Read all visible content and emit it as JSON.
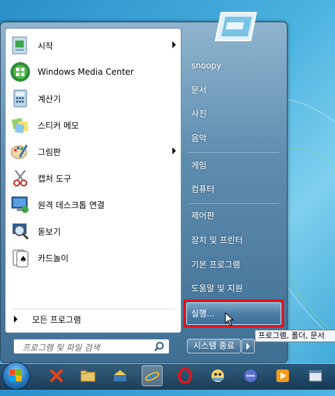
{
  "start_menu": {
    "programs": [
      {
        "label": "시작",
        "icon": "getting-started-icon",
        "has_submenu": true
      },
      {
        "label": "Windows Media Center",
        "icon": "media-center-icon",
        "has_submenu": false
      },
      {
        "label": "계산기",
        "icon": "calculator-icon",
        "has_submenu": false
      },
      {
        "label": "스티커 메모",
        "icon": "sticky-notes-icon",
        "has_submenu": false
      },
      {
        "label": "그림판",
        "icon": "paint-icon",
        "has_submenu": true
      },
      {
        "label": "캡처 도구",
        "icon": "snipping-tool-icon",
        "has_submenu": false
      },
      {
        "label": "원격 데스크톱 연결",
        "icon": "remote-desktop-icon",
        "has_submenu": false
      },
      {
        "label": "돋보기",
        "icon": "magnifier-icon",
        "has_submenu": false
      },
      {
        "label": "카드놀이",
        "icon": "solitaire-icon",
        "has_submenu": false
      }
    ],
    "all_programs_label": "모든 프로그램",
    "search_placeholder": "프로그램 및 파일 검색",
    "right_items": [
      "snoopy",
      "문서",
      "사진",
      "음악",
      "게임",
      "컴퓨터",
      "제어판",
      "장치 및 프린터",
      "기본 프로그램",
      "도움말 및 지원"
    ],
    "run_label": "실행...",
    "shutdown_label": "시스템 종료",
    "tooltip": "프로그램, 폴더, 문서",
    "highlight_color": "#e0121b"
  },
  "taskbar": {
    "items": [
      "x-app-icon",
      "folder-icon",
      "network-icon",
      "ie-icon",
      "opera-icon",
      "character-icon",
      "chat-icon",
      "media-player-icon",
      "window-icon"
    ],
    "active_index": 3
  }
}
